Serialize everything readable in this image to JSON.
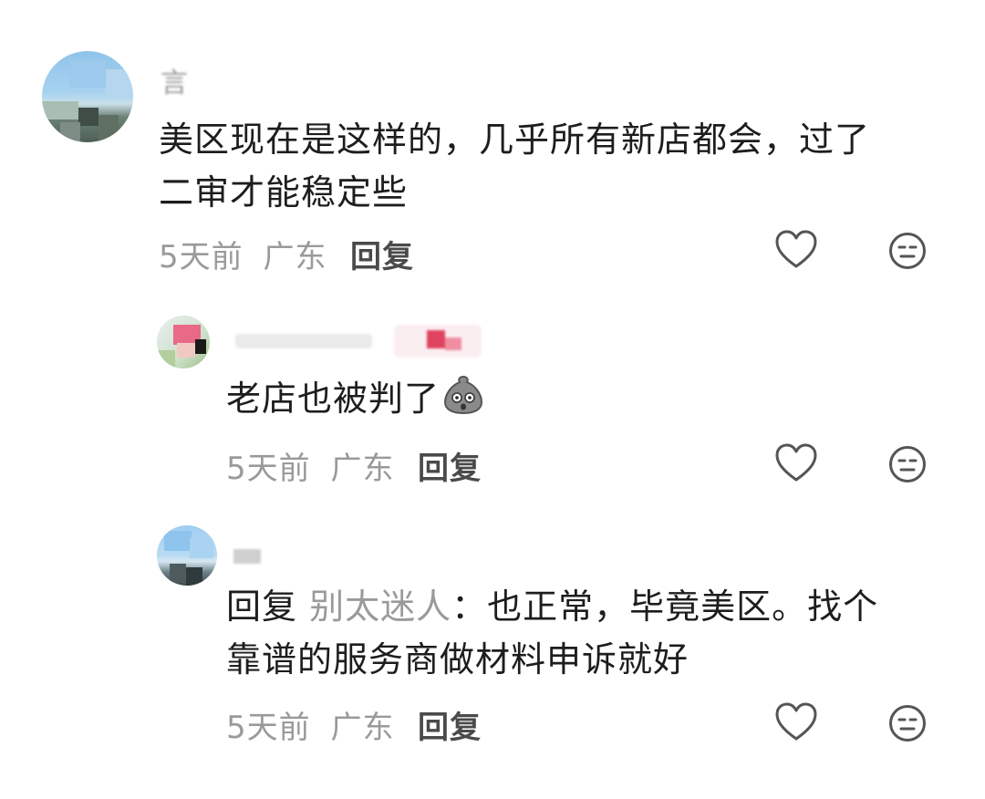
{
  "comments": [
    {
      "username": "言",
      "text_line1": "美区现在是这样的，几乎所有新店都会，过了",
      "text_line2": "二审才能稳定些",
      "time": "5天前",
      "location": "广东",
      "reply_label": "回复"
    },
    {
      "username": "",
      "text": "老店也被判了",
      "emoji": "shocked-bag-emoji",
      "time": "5天前",
      "location": "广东",
      "reply_label": "回复"
    },
    {
      "username": "",
      "reply_prefix": "回复",
      "reply_target": "别太迷人",
      "colon": "：",
      "text_line1": "也正常，毕竟美区。找个",
      "text_line2": "靠谱的服务商做材料申诉就好",
      "time": "5天前",
      "location": "广东",
      "reply_label": "回复"
    }
  ],
  "icons": {
    "like": "heart-icon",
    "dislike": "neutral-face-icon"
  },
  "colors": {
    "meta_gray": "#9a9a9a",
    "text": "#1d1d1d",
    "icon_stroke": "#555555"
  }
}
